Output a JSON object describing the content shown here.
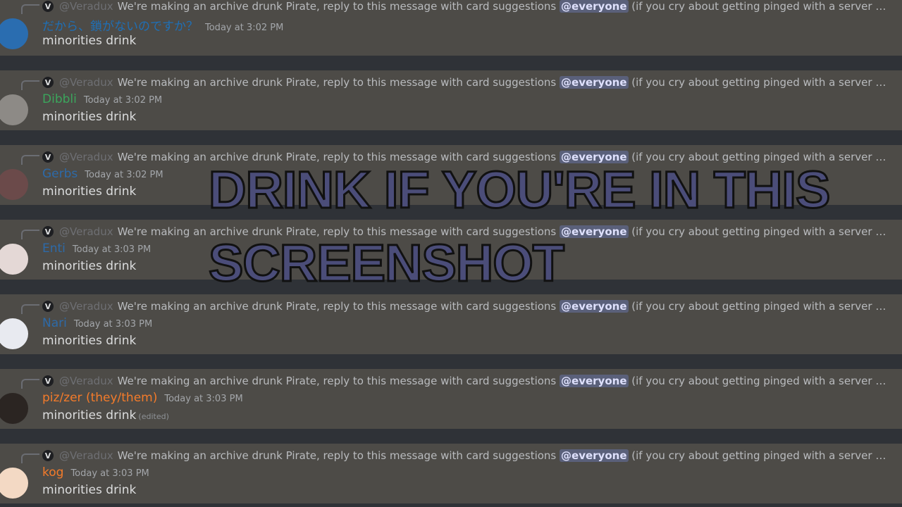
{
  "reply": {
    "avatar_letter": "V",
    "author": "@Veradux",
    "text_before": "We're making an archive drunk Pirate, reply to this message with card suggestions",
    "mention": "@everyone",
    "text_after": "(if you cry about getting pinged with a server related ping I ..."
  },
  "messages": [
    {
      "username": "だから、鎖がないのですか？",
      "username_color": "#1f6fb5",
      "timestamp": "Today at 3:02 PM",
      "content": "minorities drink",
      "edited": "",
      "avatar_color": "#2a6db0"
    },
    {
      "username": "Dibbli",
      "username_color": "#3ba55c",
      "timestamp": "Today at 3:02 PM",
      "content": "minorities drink",
      "edited": "",
      "avatar_color": "#8d8a86"
    },
    {
      "username": "Gerbs",
      "username_color": "#2d6aa8",
      "timestamp": "Today at 3:02 PM",
      "content": "minorities drink",
      "edited": "",
      "avatar_color": "#6b4a4a"
    },
    {
      "username": "Enti",
      "username_color": "#2d6aa8",
      "timestamp": "Today at 3:03 PM",
      "content": "minorities drink",
      "edited": "",
      "avatar_color": "#e4d8d6"
    },
    {
      "username": "Nari",
      "username_color": "#2d6aa8",
      "timestamp": "Today at 3:03 PM",
      "content": "minorities drink",
      "edited": "",
      "avatar_color": "#e8eaf0"
    },
    {
      "username": "piz/zer (they/them)",
      "username_color": "#f47b2a",
      "timestamp": "Today at 3:03 PM",
      "content": "minorities drink",
      "edited": "(edited)",
      "avatar_color": "#2b2522"
    },
    {
      "username": "kog",
      "username_color": "#f47b2a",
      "timestamp": "Today at 3:03 PM",
      "content": "minorities drink",
      "edited": "",
      "avatar_color": "#f3d9c4"
    }
  ],
  "overlay": {
    "line1": "DRINK IF YOU'RE IN THIS",
    "line2": "SCREENSHOT"
  }
}
